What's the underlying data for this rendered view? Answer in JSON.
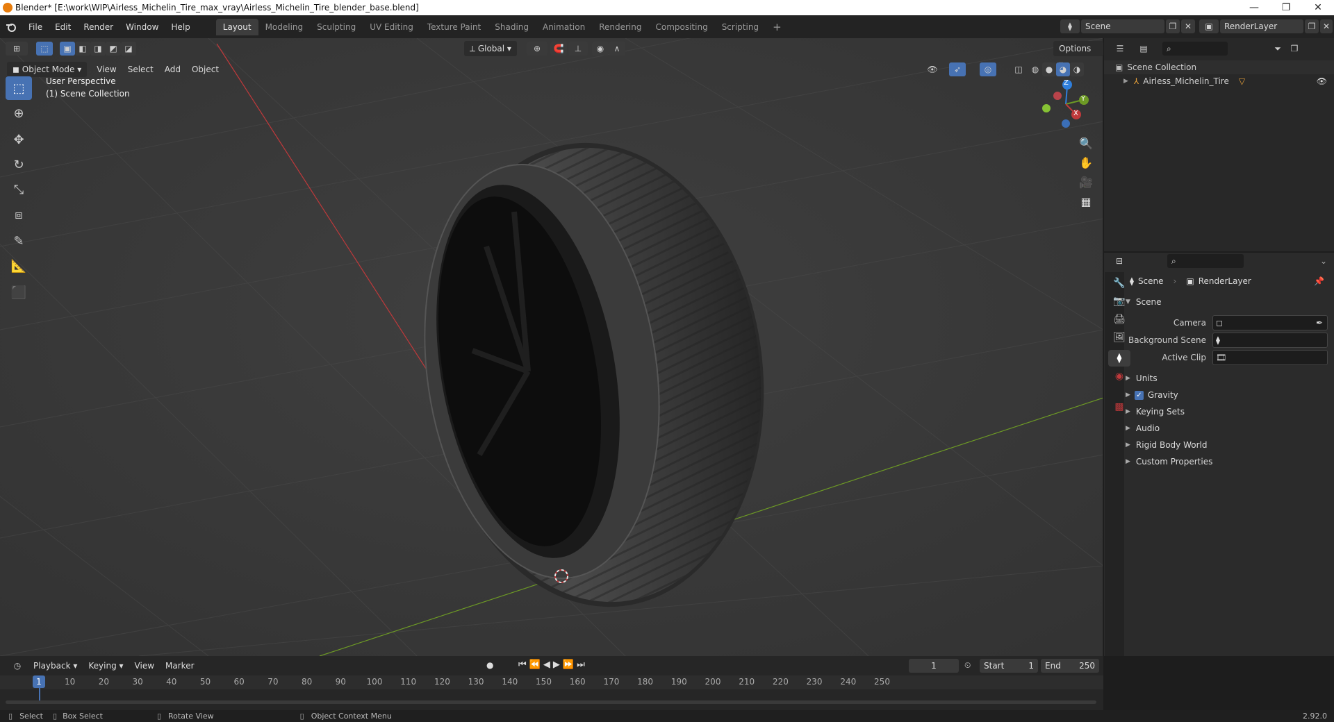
{
  "window": {
    "title": "Blender* [E:\\work\\WIP\\Airless_Michelin_Tire_max_vray\\Airless_Michelin_Tire_blender_base.blend]",
    "minimize": "—",
    "restore": "❐",
    "close": "✕"
  },
  "menu": {
    "file": "File",
    "edit": "Edit",
    "render": "Render",
    "window": "Window",
    "help": "Help"
  },
  "workspaces": [
    "Layout",
    "Modeling",
    "Sculpting",
    "UV Editing",
    "Texture Paint",
    "Shading",
    "Animation",
    "Rendering",
    "Compositing",
    "Scripting"
  ],
  "workspace_add": "+",
  "top_right": {
    "scene": "Scene",
    "render_layer": "RenderLayer"
  },
  "viewport": {
    "orientation": "Global",
    "options": "Options",
    "mode": "Object Mode",
    "menu": [
      "View",
      "Select",
      "Add",
      "Object"
    ],
    "overlay_line1": "User Perspective",
    "overlay_line2": "(1) Scene Collection",
    "gizmo": {
      "z": "Z",
      "y": "Y",
      "x": "X"
    }
  },
  "outliner": {
    "root": "Scene Collection",
    "object": "Airless_Michelin_Tire"
  },
  "properties": {
    "tab_scene": "Scene",
    "tab_layer": "RenderLayer",
    "section": "Scene",
    "camera_label": "Camera",
    "bg_scene_label": "Background Scene",
    "active_clip_label": "Active Clip",
    "panels": [
      "Units",
      "Gravity",
      "Keying Sets",
      "Audio",
      "Rigid Body World",
      "Custom Properties"
    ]
  },
  "timeline": {
    "menus": [
      "Playback",
      "Keying",
      "View",
      "Marker"
    ],
    "current_frame": "1",
    "start_label": "Start",
    "start": "1",
    "end_label": "End",
    "end": "250",
    "ticks": [
      "10",
      "20",
      "30",
      "40",
      "50",
      "60",
      "70",
      "80",
      "90",
      "100",
      "110",
      "120",
      "130",
      "140",
      "150",
      "160",
      "170",
      "180",
      "190",
      "200",
      "210",
      "220",
      "230",
      "240",
      "250"
    ],
    "playhead": "1"
  },
  "status": {
    "select": "Select",
    "box_select": "Box Select",
    "rotate_view": "Rotate View",
    "context_menu": "Object Context Menu",
    "version": "2.92.0"
  },
  "colors": {
    "accent": "#4772b3",
    "x_axis": "#c0393b",
    "y_axis": "#6d9a25",
    "z_axis": "#2f7fdc"
  }
}
